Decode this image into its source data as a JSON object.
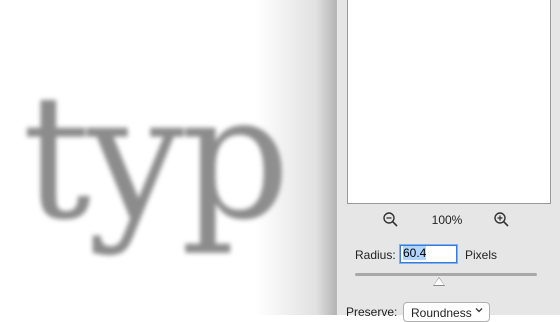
{
  "canvas": {
    "text": "typ"
  },
  "panel": {
    "zoom": {
      "level": "100%",
      "zoom_out_icon": "zoom-out-magnifier",
      "zoom_in_icon": "zoom-in-magnifier"
    },
    "radius": {
      "label": "Radius:",
      "value": "60.4",
      "unit": "Pixels"
    },
    "slider": {
      "value_fraction": 0.46
    },
    "preserve": {
      "label": "Preserve:",
      "selected": "Roundness"
    }
  },
  "colors": {
    "panel_bg": "#e6e6e6",
    "focus": "#3a7bd5",
    "selection": "#b3d4fd"
  }
}
